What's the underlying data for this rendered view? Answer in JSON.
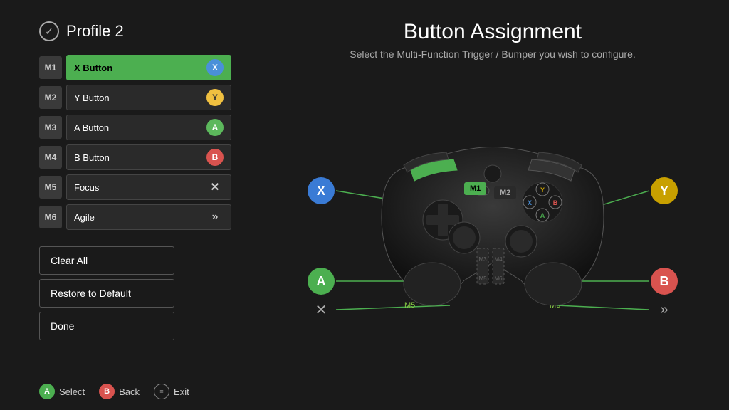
{
  "profile": {
    "label": "Profile 2"
  },
  "page_title": "Button Assignment",
  "page_subtitle": "Select the Multi-Function Trigger / Bumper you wish to configure.",
  "assignments": [
    {
      "id": "M1",
      "label": "X Button",
      "icon": "X",
      "icon_class": "x",
      "active": true
    },
    {
      "id": "M2",
      "label": "Y Button",
      "icon": "Y",
      "icon_class": "y",
      "active": false
    },
    {
      "id": "M3",
      "label": "A Button",
      "icon": "A",
      "icon_class": "a",
      "active": false
    },
    {
      "id": "M4",
      "label": "B Button",
      "icon": "B",
      "icon_class": "b",
      "active": false
    },
    {
      "id": "M5",
      "label": "Focus",
      "icon": "✕",
      "icon_class": "focus",
      "active": false
    },
    {
      "id": "M6",
      "label": "Agile",
      "icon": "»",
      "icon_class": "agile",
      "active": false
    }
  ],
  "actions": [
    {
      "id": "clear-all",
      "label": "Clear All"
    },
    {
      "id": "restore-default",
      "label": "Restore to Default"
    },
    {
      "id": "done",
      "label": "Done"
    }
  ],
  "controller": {
    "labels": {
      "x": "X",
      "y": "Y",
      "a": "A",
      "b": "B"
    },
    "zones": [
      "M1",
      "M2",
      "M3",
      "M4",
      "M5",
      "M6"
    ]
  },
  "bottom_nav": [
    {
      "badge": "A",
      "badge_class": "a",
      "label": "Select"
    },
    {
      "badge": "B",
      "badge_class": "b",
      "label": "Back"
    },
    {
      "badge": "≡",
      "badge_class": "menu",
      "label": "Exit"
    }
  ]
}
